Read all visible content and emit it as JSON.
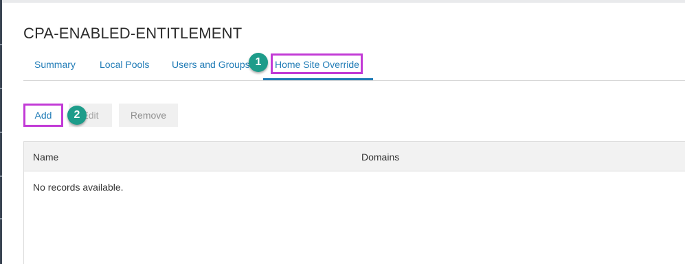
{
  "page": {
    "title": "CPA-ENABLED-ENTITLEMENT"
  },
  "tabs": [
    {
      "label": "Summary"
    },
    {
      "label": "Local Pools"
    },
    {
      "label": "Users and Groups"
    },
    {
      "label": "Home Site Override",
      "active": true
    }
  ],
  "toolbar": {
    "add_label": "Add",
    "edit_label": "Edit",
    "remove_label": "Remove"
  },
  "grid": {
    "columns": [
      "Name",
      "Domains"
    ],
    "empty_message": "No records available."
  },
  "annotations": {
    "marker_1": "1",
    "marker_2": "2"
  },
  "colors": {
    "accent": "#1f7bb6",
    "highlight": "#c23ad6",
    "marker": "#1d9c8a"
  }
}
